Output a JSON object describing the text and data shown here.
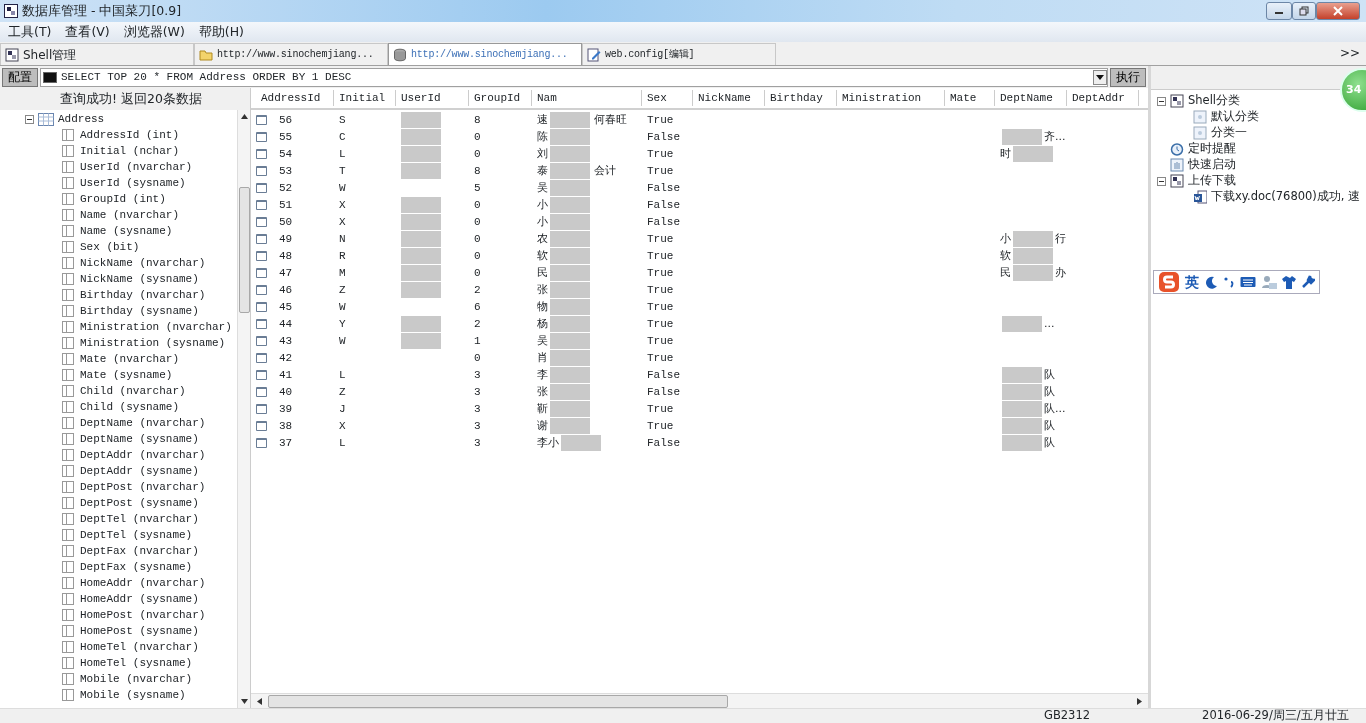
{
  "window": {
    "title": "数据库管理 - 中国菜刀[0.9]"
  },
  "menu": [
    "工具(T)",
    "查看(V)",
    "浏览器(W)",
    "帮助(H)"
  ],
  "tabs": [
    {
      "label": "Shell管理",
      "kind": "shell",
      "selected": false
    },
    {
      "label": "http://www.sinochemjiang...",
      "kind": "folder",
      "selected": false
    },
    {
      "label": "http://www.sinochemjiang...",
      "kind": "database",
      "selected": true
    },
    {
      "label": "web.config[编辑]",
      "kind": "edit",
      "selected": false
    }
  ],
  "tab_overflow": ">>",
  "config_button": "配置",
  "query": {
    "value": "SELECT TOP 20 * FROM Address ORDER BY 1 DESC",
    "run_button": "执行"
  },
  "result_message": "查询成功! 返回20条数据",
  "schema_tree": {
    "label": "Address",
    "expanded": true,
    "children": [
      {
        "label": "AddressId (int)"
      },
      {
        "label": "Initial (nchar)"
      },
      {
        "label": "UserId (nvarchar)"
      },
      {
        "label": "UserId (sysname)"
      },
      {
        "label": "GroupId (int)"
      },
      {
        "label": "Name (nvarchar)"
      },
      {
        "label": "Name (sysname)"
      },
      {
        "label": "Sex (bit)"
      },
      {
        "label": "NickName (nvarchar)"
      },
      {
        "label": "NickName (sysname)"
      },
      {
        "label": "Birthday (nvarchar)"
      },
      {
        "label": "Birthday (sysname)"
      },
      {
        "label": "Ministration (nvarchar)"
      },
      {
        "label": "Ministration (sysname)"
      },
      {
        "label": "Mate (nvarchar)"
      },
      {
        "label": "Mate (sysname)"
      },
      {
        "label": "Child (nvarchar)"
      },
      {
        "label": "Child (sysname)"
      },
      {
        "label": "DeptName (nvarchar)"
      },
      {
        "label": "DeptName (sysname)"
      },
      {
        "label": "DeptAddr (nvarchar)"
      },
      {
        "label": "DeptAddr (sysname)"
      },
      {
        "label": "DeptPost (nvarchar)"
      },
      {
        "label": "DeptPost (sysname)"
      },
      {
        "label": "DeptTel (nvarchar)"
      },
      {
        "label": "DeptTel (sysname)"
      },
      {
        "label": "DeptFax (nvarchar)"
      },
      {
        "label": "DeptFax (sysname)"
      },
      {
        "label": "HomeAddr (nvarchar)"
      },
      {
        "label": "HomeAddr (sysname)"
      },
      {
        "label": "HomePost (nvarchar)"
      },
      {
        "label": "HomePost (sysname)"
      },
      {
        "label": "HomeTel (nvarchar)"
      },
      {
        "label": "HomeTel (sysname)"
      },
      {
        "label": "Mobile (nvarchar)"
      },
      {
        "label": "Mobile (sysname)"
      }
    ]
  },
  "table": {
    "columns": [
      "AddressId",
      "Initial",
      "UserId",
      "GroupId",
      "Nam",
      "Sex",
      "NickName",
      "Birthday",
      "Ministration",
      "Mate",
      "DeptName",
      "DeptAddr"
    ],
    "rows": [
      {
        "id": "56",
        "initial": "S",
        "user_masked": true,
        "group": "8",
        "name": "速",
        "name_tail": "何春旺",
        "sex": "True"
      },
      {
        "id": "55",
        "initial": "C",
        "user_masked": true,
        "group": "0",
        "name": "陈",
        "sex": "False",
        "dept_tail": "齐..."
      },
      {
        "id": "54",
        "initial": "L",
        "user_masked": true,
        "group": "0",
        "name": "刘",
        "sex": "True",
        "dept": "时"
      },
      {
        "id": "53",
        "initial": "T",
        "user_masked": true,
        "group": "8",
        "name": "泰",
        "name_tail": "会计",
        "sex": "True"
      },
      {
        "id": "52",
        "initial": "W",
        "user_masked": false,
        "group": "5",
        "name": "吴",
        "sex": "False"
      },
      {
        "id": "51",
        "initial": "X",
        "user_masked": true,
        "group": "0",
        "name": "小",
        "sex": "False"
      },
      {
        "id": "50",
        "initial": "X",
        "user_masked": true,
        "group": "0",
        "name": "小",
        "sex": "False"
      },
      {
        "id": "49",
        "initial": "N",
        "user_masked": true,
        "group": "0",
        "name": "农",
        "sex": "True",
        "dept": "小",
        "dept_tail": "行"
      },
      {
        "id": "48",
        "initial": "R",
        "user_masked": true,
        "group": "0",
        "name": "软",
        "sex": "True",
        "dept": "软"
      },
      {
        "id": "47",
        "initial": "M",
        "user_masked": true,
        "group": "0",
        "name": "民",
        "sex": "True",
        "dept": "民",
        "dept_tail": "办"
      },
      {
        "id": "46",
        "initial": "Z",
        "user_masked": true,
        "group": "2",
        "name": "张",
        "sex": "True"
      },
      {
        "id": "45",
        "initial": "W",
        "user_masked": false,
        "group": "6",
        "name": "物",
        "sex": "True"
      },
      {
        "id": "44",
        "initial": "Y",
        "user_masked": true,
        "group": "2",
        "name": "杨",
        "sex": "True",
        "dept_tail": "..."
      },
      {
        "id": "43",
        "initial": "W",
        "user_masked": true,
        "group": "1",
        "name": "吴",
        "sex": "True"
      },
      {
        "id": "42",
        "user_masked": false,
        "group": "0",
        "name": "肖",
        "sex": "True"
      },
      {
        "id": "41",
        "initial": "L",
        "user_masked": false,
        "group": "3",
        "name": "李",
        "sex": "False",
        "dept_tail": "队"
      },
      {
        "id": "40",
        "initial": "Z",
        "user_masked": false,
        "group": "3",
        "name": "张",
        "sex": "False",
        "dept_tail": "队"
      },
      {
        "id": "39",
        "initial": "J",
        "user_masked": false,
        "group": "3",
        "name": "靳",
        "sex": "True",
        "dept_tail": "队..."
      },
      {
        "id": "38",
        "initial": "X",
        "user_masked": false,
        "group": "3",
        "name": "谢",
        "sex": "True",
        "dept_tail": "队"
      },
      {
        "id": "37",
        "initial": "L",
        "user_masked": false,
        "group": "3",
        "name": "李小",
        "sex": "False",
        "dept_tail": "队"
      }
    ]
  },
  "side_tree": [
    {
      "label": "Shell分类",
      "kind": "group",
      "expanded": true,
      "children": [
        {
          "label": "默认分类",
          "kind": "category"
        },
        {
          "label": "分类一",
          "kind": "category"
        }
      ]
    },
    {
      "label": "定时提醒",
      "kind": "clock"
    },
    {
      "label": "快速启动",
      "kind": "launch"
    },
    {
      "label": "上传下载",
      "kind": "group",
      "expanded": true,
      "children": [
        {
          "label": "下载xy.doc(76800)成功, 速",
          "kind": "doc"
        }
      ]
    }
  ],
  "floating_badge": "34",
  "ime_bar": {
    "mode": "英"
  },
  "status_bar": {
    "encoding": "GB2312",
    "date": "2016-06-29/周三/五月廿五"
  }
}
